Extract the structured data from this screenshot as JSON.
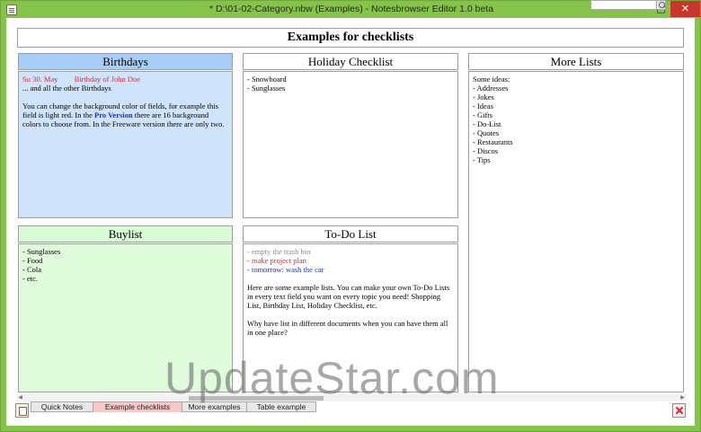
{
  "window": {
    "title": "* D:\\01-02-Category.nbw (Examples) - Notesbrowser Editor 1.0 beta"
  },
  "page_title": "Examples for checklists",
  "panels": {
    "birthdays": {
      "header": "Birthdays",
      "date": "Su 30. May",
      "event": "Birthday of John Doe",
      "line2": "... and all the other Birthdays",
      "para_a": "You can change the background color of fields, for example this field is light red. In the",
      "pro": "Pro Version",
      "para_b": "there are 16 background colors to choose from. In the Freeware version there are only two."
    },
    "holiday": {
      "header": "Holiday Checklist",
      "items": [
        "- Snowboard",
        "- Sunglasses"
      ]
    },
    "more_lists": {
      "header": "More Lists",
      "intro": "Some ideas:",
      "items": [
        "- Addresses",
        "- Jokes",
        "- Ideas",
        "- Gifts",
        "- Do-List",
        "- Quotes",
        "- Restaurants",
        "- Discos",
        "- Tips"
      ]
    },
    "buylist": {
      "header": "Buylist",
      "items": [
        "- Sunglasses",
        "- Food",
        "- Cola",
        "- etc."
      ]
    },
    "todo": {
      "header": "To-Do List",
      "item_done": "- empty the trash bin",
      "item_red": "- make project plan",
      "item_blue": "- tomorrow: wash the car",
      "para1": "Here are some example lists. You can make your own To-Do Lists in every text field you want on every topic you need! Shopping List, Birthday List, Holiday Checklist, etc.",
      "para2": "Why have list in different documents when you can have them all in one place?"
    }
  },
  "tabs": [
    "Quick Notes",
    "Example checklists",
    "More examples",
    "Table example"
  ],
  "active_tab": "Example checklists",
  "watermark": "UpdateStar.com",
  "colors": {
    "frame": "#86c34a",
    "blue_header": "#a8cdf7",
    "blue_body": "#cfe4fb",
    "green_body": "#dffbdc",
    "active_tab": "#f6c9c9"
  }
}
